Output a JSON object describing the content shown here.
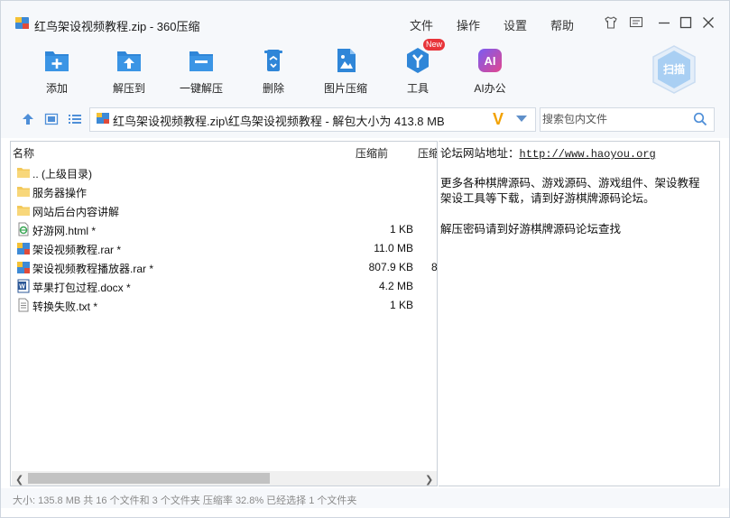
{
  "window": {
    "title": "红鸟架设视频教程.zip - 360压缩",
    "menu": [
      "文件",
      "操作",
      "设置",
      "帮助"
    ]
  },
  "toolbar": {
    "items": [
      {
        "label": "添加",
        "icon": "add-icon"
      },
      {
        "label": "解压到",
        "icon": "extract-to-icon"
      },
      {
        "label": "一键解压",
        "icon": "one-click-extract-icon"
      },
      {
        "label": "删除",
        "icon": "trash-icon"
      },
      {
        "label": "图片压缩",
        "icon": "image-compress-icon"
      },
      {
        "label": "工具",
        "icon": "tools-icon",
        "badge": "New"
      },
      {
        "label": "AI办公",
        "icon": "ai-icon",
        "icon_text": "AI"
      }
    ],
    "scan_label": "扫描"
  },
  "address": {
    "path": "红鸟架设视频教程.zip\\红鸟架设视频教程 - 解包大小为 413.8 MB",
    "badge": "V",
    "search_placeholder": "搜索包内文件"
  },
  "list": {
    "headers": {
      "name": "名称",
      "size": "压缩前",
      "packed": "压缩"
    },
    "rows": [
      {
        "name": ".. (上级目录)",
        "size": "",
        "size2": "",
        "icon": "folder-icon"
      },
      {
        "name": "服务器操作",
        "size": "",
        "size2": "",
        "icon": "folder-icon"
      },
      {
        "name": "网站后台内容讲解",
        "size": "",
        "size2": "",
        "icon": "folder-icon"
      },
      {
        "name": "好游网.html *",
        "size": "1 KB",
        "size2": "",
        "icon": "html-file-icon"
      },
      {
        "name": "架设视频教程.rar *",
        "size": "11.0 MB",
        "size2": "",
        "icon": "rar-file-icon"
      },
      {
        "name": "架设视频教程播放器.rar *",
        "size": "807.9 KB",
        "size2": "8",
        "icon": "rar-file-icon"
      },
      {
        "name": "苹果打包过程.docx *",
        "size": "4.2 MB",
        "size2": "",
        "icon": "word-file-icon"
      },
      {
        "name": "转换失败.txt *",
        "size": "1 KB",
        "size2": "",
        "icon": "text-file-icon"
      }
    ]
  },
  "info": {
    "line1_prefix": "论坛网站地址：",
    "line1_link": "http://www.haoyou.org",
    "line2": "更多各种棋牌源码、游戏源码、游戏组件、架设教程",
    "line3": "架设工具等下载，请到好游棋牌源码论坛。",
    "line4": "解压密码请到好游棋牌源码论坛查找"
  },
  "status": {
    "text": "大小: 135.8 MB 共 16 个文件和 3 个文件夹 压缩率 32.8% 已经选择 1 个文件夹"
  },
  "colors": {
    "accent": "#2f86d8",
    "toolbar_bg": "#f6f8fb",
    "new_badge": "#e8343a",
    "v_mark": "#f2a100"
  }
}
